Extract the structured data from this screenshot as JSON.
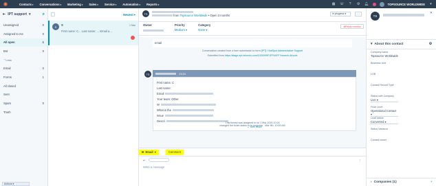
{
  "nav": {
    "items": [
      "Contacts",
      "Conversations",
      "Marketing",
      "Sales",
      "Service",
      "Automation",
      "Reports"
    ],
    "company": "TOPSOURCE WORLDWIDE"
  },
  "inbox": {
    "title": "IPT support",
    "items": [
      {
        "label": "Unassigned",
        "count": "0"
      },
      {
        "label": "Assigned to me",
        "count": "0"
      },
      {
        "label": "All open",
        "count": "1"
      },
      {
        "label": "Bot",
        "count": "0"
      }
    ],
    "views_label": "Less",
    "channel_items": [
      {
        "label": "Email",
        "count": "0"
      },
      {
        "label": "Forms",
        "count": "1"
      },
      {
        "label": "All closed",
        "count": ""
      },
      {
        "label": "Sent",
        "count": ""
      },
      {
        "label": "Spam",
        "count": "0"
      },
      {
        "label": "Trash",
        "count": ""
      }
    ],
    "actions": "Actions"
  },
  "convlist": {
    "sort": "Newest",
    "card": {
      "avatar": "S",
      "name": "S",
      "time": "1 Mar",
      "preview": "First name: C... Last name: ... Email a..."
    }
  },
  "thread": {
    "avatar": "TS",
    "from_text": "from",
    "from_link": "Topsource Worldwide",
    "open_text": "• Open 3 months",
    "status": "In progress",
    "owner_label": "Owner",
    "priority_label": "Priority",
    "priority_value": "Medium",
    "category_label": "Category",
    "category_value": "None",
    "reply_overdue": "Reply overdue",
    "prev_email_label": "email",
    "conv_created": "Conversation created from a form submission to form",
    "conv_form": "[IPT]: HubSpot Administrative Support",
    "submitted_from": "Submitted from",
    "submitted_link": "https://stage.ept.tsformic.com/1030099F1FF9AFF?/search-Afroutx",
    "msg_avatar": "TS",
    "msg_time": "13:24",
    "msg_lines": [
      "First name: C",
      "Last name: ",
      "Email ",
      "Your team: Other",
      "W",
      "What is the ",
      "Issue ",
      "Descri"
    ],
    "see_more": "See more",
    "assigned_text": "This thread was assigned to",
    "assigned_date": "on 1 Mar 2024 10:24",
    "marked": "changed the ticket status to In progress · Mar 9th, 10:59 AM",
    "tab_email": "Email",
    "tab_comment": "Comment",
    "write_placeholder": "Write a message"
  },
  "contact": {
    "avatar": "TS",
    "section": "About this contact",
    "props": [
      {
        "label": "Company name",
        "value": "Topsource Worldwide"
      },
      {
        "label": "Business Unit",
        "value": ""
      },
      {
        "label": "LOB",
        "value": ""
      },
      {
        "label": "Contact Record Type",
        "value": ""
      },
      {
        "label": "Status with Company",
        "value": "Live"
      },
      {
        "label": "Final Level",
        "value": "Operational Contact"
      },
      {
        "label": "Lead status",
        "value": "Converted"
      },
      {
        "label": "Status Variance",
        "value": ""
      },
      {
        "label": "Contact owner",
        "value": ""
      }
    ],
    "companies": "Companies (1)"
  }
}
